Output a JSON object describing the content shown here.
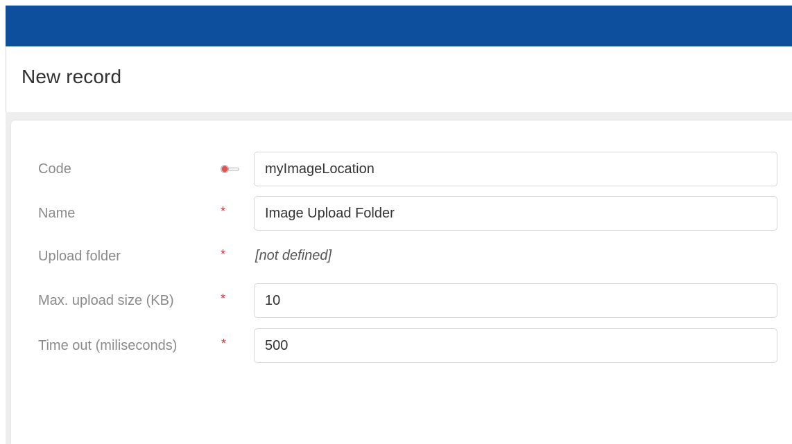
{
  "header": {
    "title": "New record"
  },
  "form": {
    "fields": [
      {
        "label": "Code",
        "marker": "key",
        "value": "myImageLocation"
      },
      {
        "label": "Name",
        "marker": "*",
        "value": "Image Upload Folder"
      },
      {
        "label": "Upload folder",
        "marker": "*",
        "value": "[not defined]"
      },
      {
        "label": "Max. upload size (KB)",
        "marker": "*",
        "value": "10"
      },
      {
        "label": "Time out (miliseconds)",
        "marker": "*",
        "value": "500"
      }
    ]
  },
  "colors": {
    "topbar": "#0d4f9c",
    "required": "#d9343a",
    "label": "#8a8a8a"
  },
  "icons": {
    "code_marker": "key-icon"
  }
}
